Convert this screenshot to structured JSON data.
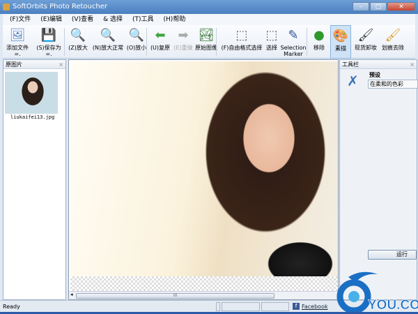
{
  "window": {
    "title": "SoftOrbits Photo Retoucher",
    "minimize": "–",
    "maximize": "□",
    "close": "✕"
  },
  "menu": [
    "(F)文件",
    "(E)编辑",
    "(V)查看",
    "& 选择",
    "(T)工具",
    "(H)帮助"
  ],
  "toolbar": [
    {
      "label": "添加文件=.",
      "icon": "add-file-icon",
      "glyph": "🖼"
    },
    {
      "label": "(S)保存为=.",
      "icon": "save-icon",
      "glyph": "💾"
    },
    {
      "label": "(Z)放大",
      "icon": "zoom-in-icon",
      "glyph": "🔍"
    },
    {
      "label": "(N)放大正常",
      "icon": "zoom-normal-icon",
      "glyph": "🔍"
    },
    {
      "label": "(O)放小",
      "icon": "zoom-out-icon",
      "glyph": "🔍"
    },
    {
      "label": "(U)复原",
      "icon": "undo-icon",
      "glyph": "⬅"
    },
    {
      "label": "(E)重做",
      "icon": "redo-icon",
      "glyph": "➡"
    },
    {
      "label": "原始图像",
      "icon": "original-image-icon",
      "glyph": "🏞"
    },
    {
      "label": "(F)自由格式选择",
      "icon": "lasso-select-icon",
      "glyph": "⬚"
    },
    {
      "label": "选择",
      "icon": "rect-select-icon",
      "glyph": "⬚"
    },
    {
      "label": "Selection Marker",
      "icon": "selection-marker-icon",
      "glyph": "✎"
    },
    {
      "label": "移除",
      "icon": "remove-icon",
      "glyph": "●"
    },
    {
      "label": "素描",
      "icon": "sketch-icon",
      "glyph": "🎨"
    },
    {
      "label": "现货卸妆",
      "icon": "spot-removal-icon",
      "glyph": "🖌"
    },
    {
      "label": "划痕去除",
      "icon": "scratch-removal-icon",
      "glyph": "🖌"
    }
  ],
  "left_panel": {
    "title": "原图片",
    "close": "×",
    "thumbnail_name": "liukaifei13.jpg"
  },
  "right_panel": {
    "title": "工具栏",
    "close": "×",
    "preset_label": "预设",
    "preset_value": "在柔和的色彩",
    "run_label": "运行"
  },
  "canvas": {
    "scroll_grip": "III"
  },
  "status": {
    "text": "Ready",
    "facebook": "Facebook"
  },
  "watermark": "YOU.COM"
}
